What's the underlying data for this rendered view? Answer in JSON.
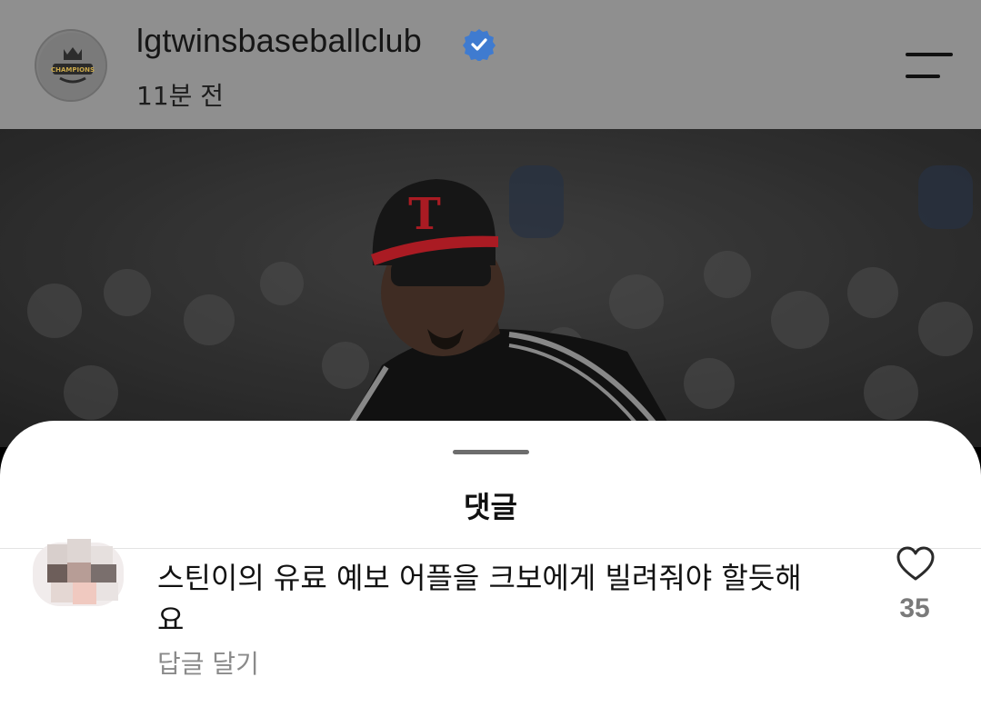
{
  "post": {
    "username": "lgtwinsbaseballclub",
    "time": "11분 전",
    "avatar_text": "CHAMPIONS",
    "verified_icon": "verified-badge-icon",
    "menu_icon": "menu-icon"
  },
  "comments_sheet": {
    "title": "댓글",
    "comments": [
      {
        "text": "스틴이의 유료 예보 어플을 크보에게 빌려줘야 할듯해요",
        "reply_label": "답글 달기",
        "like_count": "35",
        "like_icon": "heart-icon"
      }
    ]
  },
  "colors": {
    "header_bg": "#8f8f8f",
    "verified": "#3f7bd0",
    "cap_red": "#d6232d"
  }
}
